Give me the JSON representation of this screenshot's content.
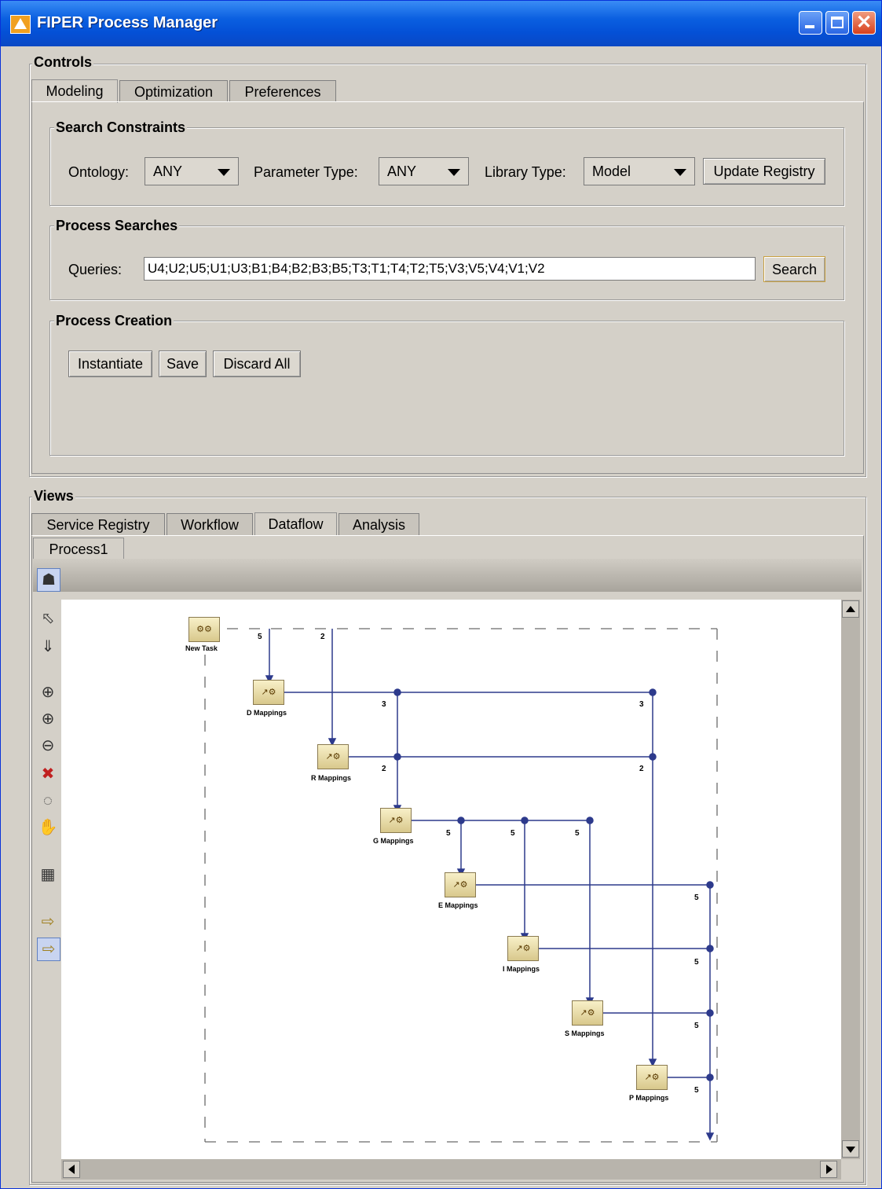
{
  "window": {
    "title": "FIPER Process Manager"
  },
  "controls": {
    "label": "Controls",
    "tabs": [
      {
        "label": "Modeling"
      },
      {
        "label": "Optimization"
      },
      {
        "label": "Preferences"
      }
    ],
    "search_constraints": {
      "label": "Search Constraints",
      "ontology_label": "Ontology:",
      "ontology_value": "ANY",
      "parameter_type_label": "Parameter Type:",
      "parameter_type_value": "ANY",
      "library_type_label": "Library Type:",
      "library_type_value": "Model",
      "update_registry": "Update Registry"
    },
    "process_searches": {
      "label": "Process Searches",
      "queries_label": "Queries:",
      "queries_value": "U4;U2;U5;U1;U3;B1;B4;B2;B3;B5;T3;T1;T4;T2;T5;V3;V5;V4;V1;V2",
      "search_button": "Search"
    },
    "process_creation": {
      "label": "Process Creation",
      "instantiate": "Instantiate",
      "save": "Save",
      "discard_all": "Discard All"
    }
  },
  "views": {
    "label": "Views",
    "tabs": [
      {
        "label": "Service Registry"
      },
      {
        "label": "Workflow"
      },
      {
        "label": "Dataflow"
      },
      {
        "label": "Analysis"
      }
    ],
    "process_tab": "Process1",
    "tools": [
      "hierarchy-layout-icon",
      "select-arrow-icon",
      "drill-down-icon",
      "zoom-fit-icon",
      "zoom-in-icon",
      "zoom-out-icon",
      "zoom-reset-icon",
      "zoom-100-icon",
      "pan-hand-icon",
      "grid-icon",
      "export-icon",
      "compare-icon"
    ],
    "diagram": {
      "tasks": [
        {
          "name": "New Task"
        },
        {
          "name": "D Mappings"
        },
        {
          "name": "R Mappings"
        },
        {
          "name": "G Mappings"
        },
        {
          "name": "E Mappings"
        },
        {
          "name": "I Mappings"
        },
        {
          "name": "S Mappings"
        },
        {
          "name": "P Mappings"
        }
      ],
      "edge_labels": [
        "5",
        "2",
        "3",
        "3",
        "2",
        "2",
        "5",
        "5",
        "5",
        "5",
        "5",
        "5",
        "5"
      ]
    }
  }
}
